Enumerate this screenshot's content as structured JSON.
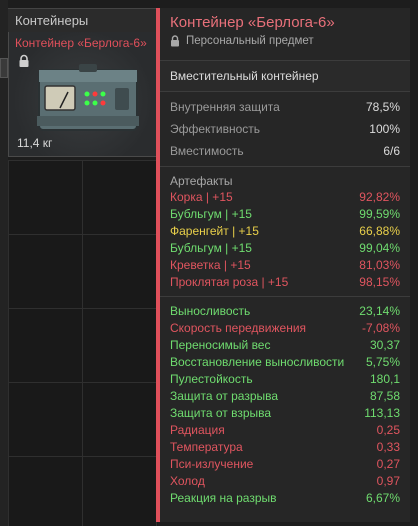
{
  "slot": {
    "title": "Контейнеры",
    "item_name": "Контейнер «Берлога-6»",
    "weight": "11,4 кг",
    "icon": "lock-icon"
  },
  "tooltip": {
    "title": "Контейнер «Берлога-6»",
    "personal": "Персональный предмет",
    "type": "Вместительный контейнер",
    "basic": [
      {
        "label": "Внутренняя защита",
        "value": "78,5%"
      },
      {
        "label": "Эффективность",
        "value": "100%"
      },
      {
        "label": "Вместимость",
        "value": "6/6"
      }
    ],
    "artifacts_title": "Артефакты",
    "artifacts": [
      {
        "label": "Корка | +15",
        "value": "92,82%",
        "color": "red"
      },
      {
        "label": "Бубльгум | +15",
        "value": "99,59%",
        "color": "green"
      },
      {
        "label": "Фаренгейт | +15",
        "value": "66,88%",
        "color": "yellow"
      },
      {
        "label": "Бубльгум | +15",
        "value": "99,04%",
        "color": "green"
      },
      {
        "label": "Креветка | +15",
        "value": "81,03%",
        "color": "red"
      },
      {
        "label": "Проклятая роза | +15",
        "value": "98,15%",
        "color": "red"
      }
    ],
    "stats": [
      {
        "label": "Выносливость",
        "value": "23,14%",
        "color": "green"
      },
      {
        "label": "Скорость передвижения",
        "value": "-7,08%",
        "color": "red"
      },
      {
        "label": "Переносимый вес",
        "value": "30,37",
        "color": "green"
      },
      {
        "label": "Восстановление выносливости",
        "value": "5,75%",
        "color": "green"
      },
      {
        "label": "Пулестойкость",
        "value": "180,1",
        "color": "green"
      },
      {
        "label": "Защита от разрыва",
        "value": "87,58",
        "color": "green"
      },
      {
        "label": "Защита от взрыва",
        "value": "113,13",
        "color": "green"
      },
      {
        "label": "Радиация",
        "value": "0,25",
        "color": "red"
      },
      {
        "label": "Температура",
        "value": "0,33",
        "color": "red"
      },
      {
        "label": "Пси-излучение",
        "value": "0,27",
        "color": "red"
      },
      {
        "label": "Холод",
        "value": "0,97",
        "color": "red"
      },
      {
        "label": "Реакция на разрыв",
        "value": "6,67%",
        "color": "green"
      }
    ]
  },
  "colors": {
    "accent": "#e0505b",
    "red": "#e0555f",
    "green": "#6fdc6f",
    "yellow": "#e8cf4a"
  }
}
